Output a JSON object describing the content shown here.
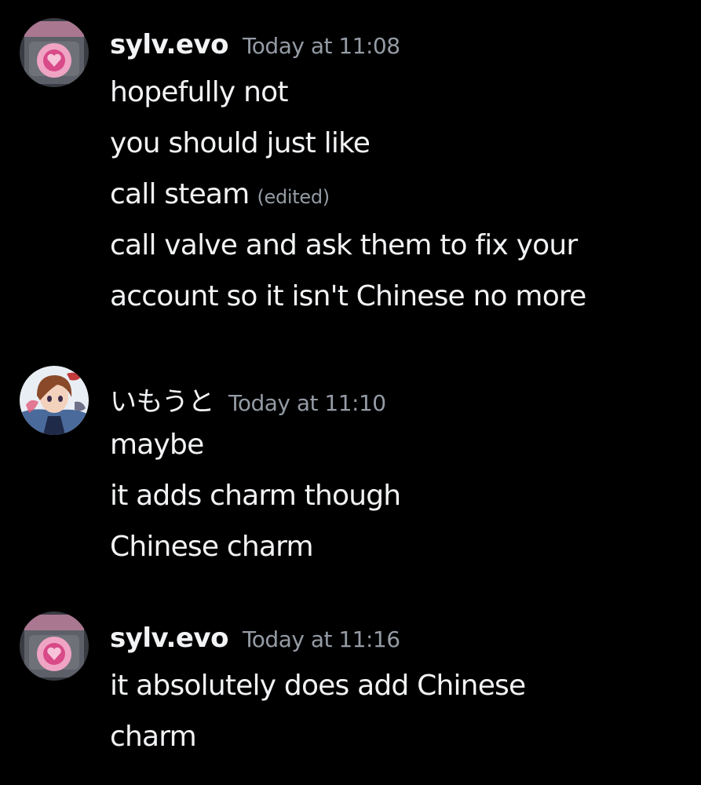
{
  "messages": [
    {
      "username": "sylv.evo",
      "timestamp": "Today at 11:08",
      "avatar_icon": "pink-cube-avatar-icon",
      "lines": [
        {
          "text": "hopefully not",
          "edited": ""
        },
        {
          "text": "you should just like",
          "edited": ""
        },
        {
          "text": "call steam",
          "edited": "(edited)"
        },
        {
          "text": "call valve and ask them to fix your",
          "edited": ""
        },
        {
          "text": "account so it isn't Chinese no more",
          "edited": ""
        }
      ]
    },
    {
      "username": "いもうと",
      "timestamp": "Today at 11:10",
      "avatar_icon": "anime-character-avatar-icon",
      "lines": [
        {
          "text": "maybe",
          "edited": ""
        },
        {
          "text": "it adds charm though",
          "edited": ""
        },
        {
          "text": "Chinese charm",
          "edited": ""
        }
      ]
    },
    {
      "username": "sylv.evo",
      "timestamp": "Today at 11:16",
      "avatar_icon": "pink-cube-avatar-icon",
      "lines": [
        {
          "text": "it absolutely does add Chinese",
          "edited": ""
        },
        {
          "text": "charm",
          "edited": ""
        }
      ]
    }
  ],
  "colors": {
    "background": "#000000",
    "text": "#f2f3f5",
    "muted": "#949ba4"
  }
}
